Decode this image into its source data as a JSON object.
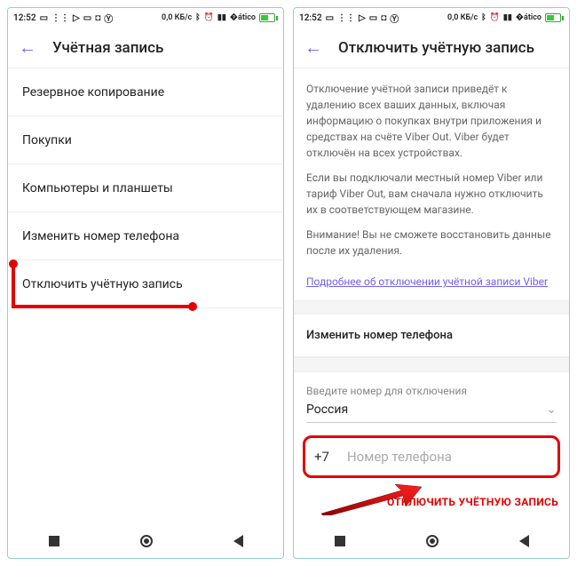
{
  "status": {
    "time": "12:52",
    "net": "0,0 КБ/с"
  },
  "left": {
    "title": "Учётная запись",
    "items": [
      "Резервное копирование",
      "Покупки",
      "Компьютеры и планшеты",
      "Изменить номер телефона",
      "Отключить учётную запись"
    ]
  },
  "right": {
    "title": "Отключить учётную запись",
    "p1": "Отключение учётной записи приведёт к удалению всех ваших данных, включая информацию о покупках внутри приложения и средствах на счёте Viber Out. Viber будет отключён на всех устройствах.",
    "p2": "Если вы подключали местный номер Viber или тариф Viber Out, вам сначала нужно отключить их в соответствующем магазине.",
    "p3": "Внимание! Вы не сможете восстановить данные после их удаления.",
    "link": "Подробнее об отключении учётной записи Viber",
    "change_num": "Изменить номер телефона",
    "enter_label": "Введите номер для отключения",
    "country": "Россия",
    "prefix": "+7",
    "placeholder": "Номер телефона",
    "deactivate": "ОТКЛЮЧИТЬ УЧЁТНУЮ ЗАПИСЬ"
  }
}
